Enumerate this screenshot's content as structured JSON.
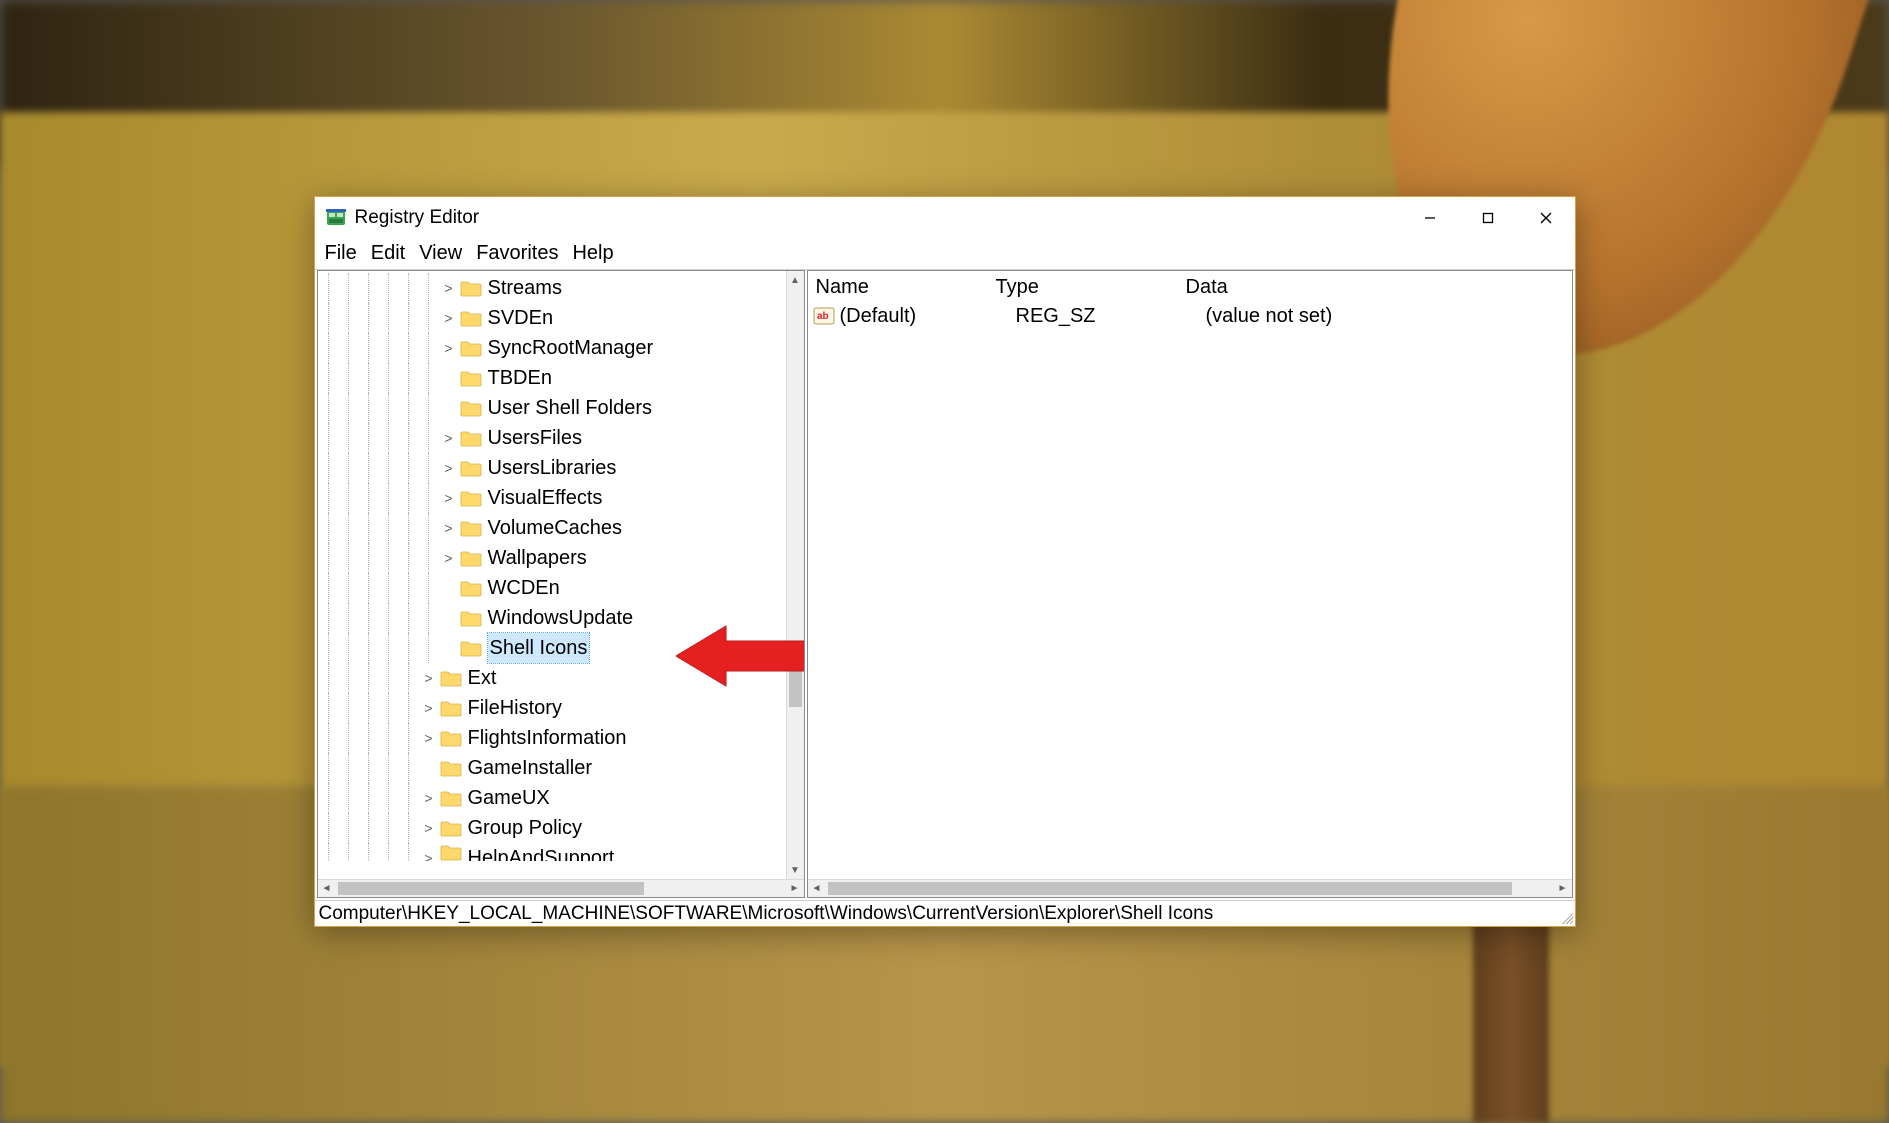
{
  "window": {
    "title": "Registry Editor"
  },
  "menu": {
    "items": [
      "File",
      "Edit",
      "View",
      "Favorites",
      "Help"
    ]
  },
  "tree": {
    "nodes": [
      {
        "depth": 6,
        "expander": ">",
        "label": "Streams"
      },
      {
        "depth": 6,
        "expander": ">",
        "label": "SVDEn"
      },
      {
        "depth": 6,
        "expander": ">",
        "label": "SyncRootManager"
      },
      {
        "depth": 6,
        "expander": "",
        "label": "TBDEn"
      },
      {
        "depth": 6,
        "expander": "",
        "label": "User Shell Folders"
      },
      {
        "depth": 6,
        "expander": ">",
        "label": "UsersFiles"
      },
      {
        "depth": 6,
        "expander": ">",
        "label": "UsersLibraries"
      },
      {
        "depth": 6,
        "expander": ">",
        "label": "VisualEffects"
      },
      {
        "depth": 6,
        "expander": ">",
        "label": "VolumeCaches"
      },
      {
        "depth": 6,
        "expander": ">",
        "label": "Wallpapers"
      },
      {
        "depth": 6,
        "expander": "",
        "label": "WCDEn"
      },
      {
        "depth": 6,
        "expander": "",
        "label": "WindowsUpdate"
      },
      {
        "depth": 6,
        "expander": "",
        "label": "Shell Icons",
        "selected": true
      },
      {
        "depth": 5,
        "expander": ">",
        "label": "Ext"
      },
      {
        "depth": 5,
        "expander": ">",
        "label": "FileHistory"
      },
      {
        "depth": 5,
        "expander": ">",
        "label": "FlightsInformation"
      },
      {
        "depth": 5,
        "expander": "",
        "label": "GameInstaller"
      },
      {
        "depth": 5,
        "expander": ">",
        "label": "GameUX"
      },
      {
        "depth": 5,
        "expander": ">",
        "label": "Group Policy"
      },
      {
        "depth": 5,
        "expander": ">",
        "label": "HelpAndSupport",
        "clipped": true
      }
    ]
  },
  "list": {
    "columns": {
      "name": "Name",
      "type": "Type",
      "data": "Data"
    },
    "rows": [
      {
        "name": "(Default)",
        "type": "REG_SZ",
        "data": "(value not set)"
      }
    ]
  },
  "statusbar": {
    "path": "Computer\\HKEY_LOCAL_MACHINE\\SOFTWARE\\Microsoft\\Windows\\CurrentVersion\\Explorer\\Shell Icons"
  },
  "annotation": {
    "arrow_target": "Shell Icons"
  }
}
